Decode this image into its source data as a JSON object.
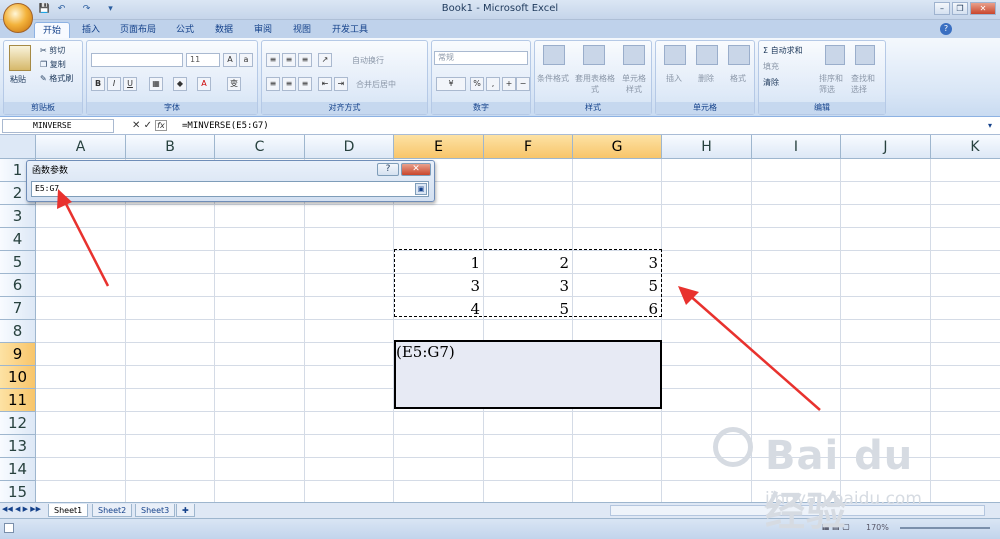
{
  "window": {
    "title": "Book1 - Microsoft Excel",
    "min": "–",
    "restore": "❐",
    "close": "✕"
  },
  "quick_access": [
    "💾",
    "↶",
    "↷",
    "▾"
  ],
  "tabs": [
    "开始",
    "插入",
    "页面布局",
    "公式",
    "数据",
    "审阅",
    "视图",
    "开发工具"
  ],
  "ribbon": {
    "clipboard": {
      "label": "剪贴板",
      "paste": "粘贴",
      "cut": "剪切",
      "copy": "复制",
      "format_painter": "格式刷"
    },
    "font": {
      "label": "字体",
      "size": "11",
      "bold": "B",
      "italic": "I",
      "underline": "U"
    },
    "alignment": {
      "label": "对齐方式",
      "wrap": "自动换行",
      "merge": "合并后居中"
    },
    "number": {
      "label": "数字",
      "format": "常规",
      "percent": "%",
      "comma": ","
    },
    "styles": {
      "label": "样式",
      "conditional": "条件格式",
      "table": "套用表格格式",
      "cell_styles": "单元格样式"
    },
    "cells": {
      "label": "单元格",
      "insert": "插入",
      "delete": "删除",
      "format": "格式"
    },
    "editing": {
      "label": "编辑",
      "autosum": "Σ 自动求和",
      "fill": "填充",
      "clear": "清除",
      "sort": "排序和筛选",
      "find": "查找和选择"
    }
  },
  "formula_bar": {
    "name_box": "MINVERSE",
    "formula": "=MINVERSE(E5:G7)",
    "fx": "fx",
    "cancel": "✕",
    "enter": "✓"
  },
  "columns": [
    "A",
    "B",
    "C",
    "D",
    "E",
    "F",
    "G",
    "H",
    "I",
    "J",
    "K"
  ],
  "rows": [
    "1",
    "2",
    "3",
    "4",
    "5",
    "6",
    "7",
    "8",
    "9",
    "10",
    "11",
    "12",
    "13",
    "14",
    "15"
  ],
  "cells": [
    {
      "ref": "E5",
      "value": "1"
    },
    {
      "ref": "F5",
      "value": "2"
    },
    {
      "ref": "G5",
      "value": "3"
    },
    {
      "ref": "E6",
      "value": "3"
    },
    {
      "ref": "F6",
      "value": "3"
    },
    {
      "ref": "G6",
      "value": "5"
    },
    {
      "ref": "E7",
      "value": "4"
    },
    {
      "ref": "F7",
      "value": "5"
    },
    {
      "ref": "G7",
      "value": "6"
    }
  ],
  "edit_cell": {
    "ref": "E9",
    "text": "(E5:G7)"
  },
  "dialog": {
    "title": "函数参数",
    "value": "E5:G7",
    "help": "?",
    "close": "✕"
  },
  "sheets": [
    "Sheet1",
    "Sheet2",
    "Sheet3"
  ],
  "status": {
    "zoom": "170%"
  },
  "colors": {
    "accent": "#15428b",
    "selected_header": "#f8c56a",
    "arrow": "#e8322e"
  },
  "watermark": {
    "brand": "Bai du 经验",
    "url": "jingyan.baidu.com"
  }
}
